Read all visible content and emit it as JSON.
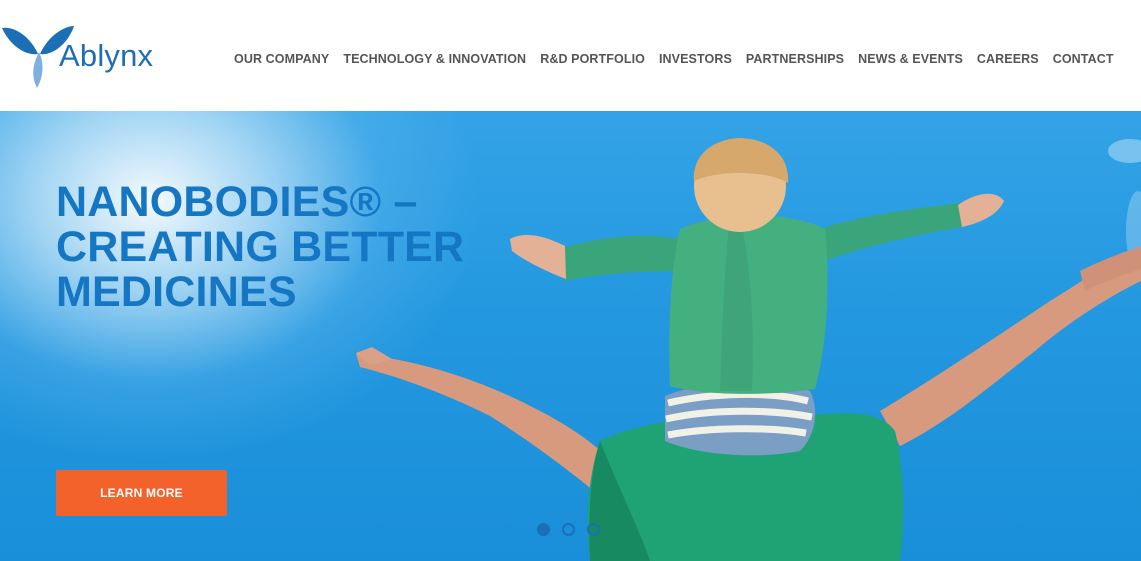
{
  "brand": {
    "name": "Ablynx",
    "colors": {
      "primary": "#1f6db4",
      "logo_dark": "#1b6fb5",
      "logo_light": "#7fb0dd"
    }
  },
  "nav": {
    "items": [
      {
        "label": "OUR COMPANY"
      },
      {
        "label": "TECHNOLOGY & INNOVATION"
      },
      {
        "label": "R&D PORTFOLIO"
      },
      {
        "label": "INVESTORS"
      },
      {
        "label": "PARTNERSHIPS"
      },
      {
        "label": "NEWS & EVENTS"
      },
      {
        "label": "CAREERS"
      },
      {
        "label": "CONTACT"
      }
    ],
    "color": "#555555"
  },
  "hero": {
    "headline_lines": [
      "NANOBODIES® –",
      "CREATING BETTER",
      "MEDICINES"
    ],
    "headline_color": "#1576c3",
    "cta_label": "LEARN MORE",
    "cta_color": "#f4622b",
    "image_description_icon": "photo-child-on-shoulders",
    "carousel": {
      "slide_count": 3,
      "active_index": 0
    }
  }
}
